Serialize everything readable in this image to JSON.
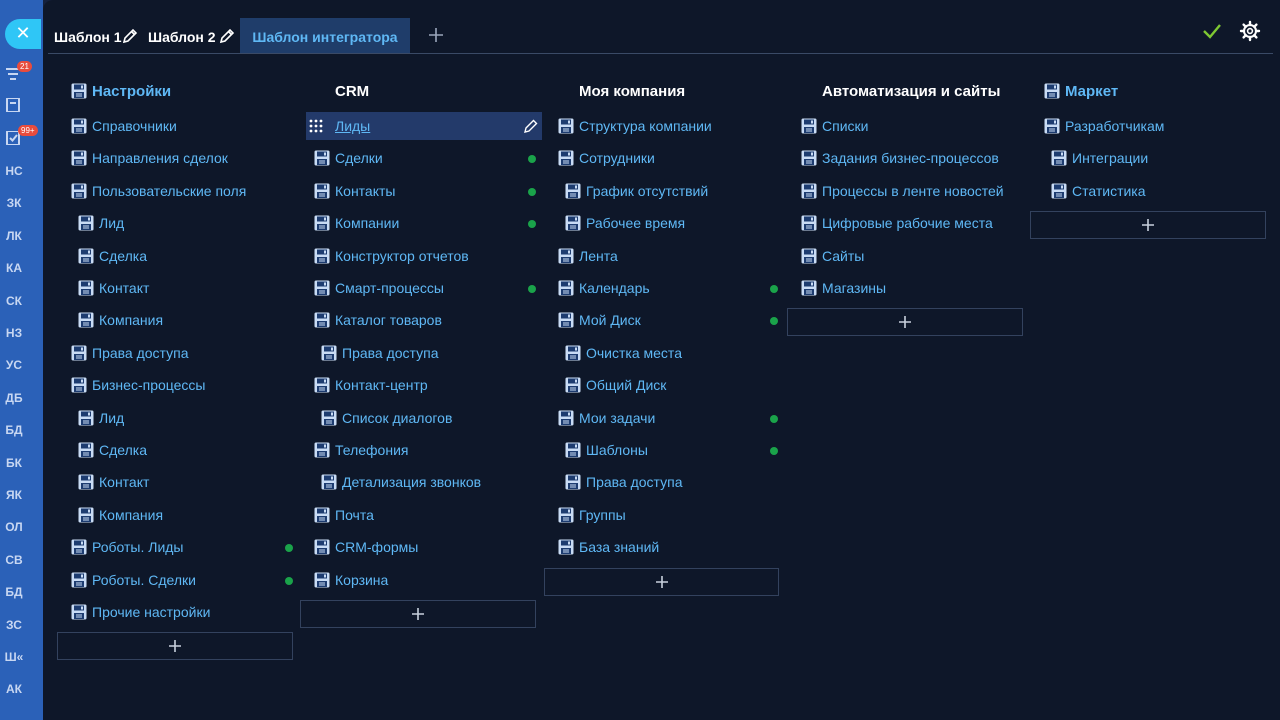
{
  "left_rail": {
    "filter_badge": "21",
    "tasks_badge": "99+",
    "abbreviations": [
      "НС",
      "ЗК",
      "ЛК",
      "КА",
      "СК",
      "НЗ",
      "УС",
      "ДБ",
      "БД",
      "БК",
      "ЯК",
      "ОЛ",
      "СВ",
      "БД",
      "ЗС",
      "Ш«",
      "АК"
    ]
  },
  "tabs": [
    {
      "label": "Шаблон 1"
    },
    {
      "label": "Шаблон 2"
    },
    {
      "label": "Шаблон интегратора",
      "active": true
    }
  ],
  "columns": [
    {
      "title": "Настройки",
      "title_is_link": true,
      "items": [
        {
          "label": "Справочники",
          "level": 0
        },
        {
          "label": "Направления сделок",
          "level": 0
        },
        {
          "label": "Пользовательские поля",
          "level": 0
        },
        {
          "label": "Лид",
          "level": 1
        },
        {
          "label": "Сделка",
          "level": 1
        },
        {
          "label": "Контакт",
          "level": 1
        },
        {
          "label": "Компания",
          "level": 1
        },
        {
          "label": "Права доступа",
          "level": 0
        },
        {
          "label": "Бизнес-процессы",
          "level": 0
        },
        {
          "label": "Лид",
          "level": 1
        },
        {
          "label": "Сделка",
          "level": 1
        },
        {
          "label": "Контакт",
          "level": 1
        },
        {
          "label": "Компания",
          "level": 1
        },
        {
          "label": "Роботы. Лиды",
          "level": 0,
          "status": "active"
        },
        {
          "label": "Роботы. Сделки",
          "level": 0,
          "status": "active"
        },
        {
          "label": "Прочие настройки",
          "level": 0
        }
      ]
    },
    {
      "title": "CRM",
      "title_is_link": false,
      "items": [
        {
          "label": "Лиды",
          "level": 0,
          "highlighted": true
        },
        {
          "label": "Сделки",
          "level": 0,
          "status": "active"
        },
        {
          "label": "Контакты",
          "level": 0,
          "status": "active"
        },
        {
          "label": "Компании",
          "level": 0,
          "status": "active"
        },
        {
          "label": "Конструктор отчетов",
          "level": 0
        },
        {
          "label": "Смарт-процессы",
          "level": 0,
          "status": "active"
        },
        {
          "label": "Каталог товаров",
          "level": 0
        },
        {
          "label": "Права доступа",
          "level": 1
        },
        {
          "label": "Контакт-центр",
          "level": 0
        },
        {
          "label": "Список диалогов",
          "level": 1
        },
        {
          "label": "Телефония",
          "level": 0
        },
        {
          "label": "Детализация звонков",
          "level": 1
        },
        {
          "label": "Почта",
          "level": 0
        },
        {
          "label": "CRM-формы",
          "level": 0
        },
        {
          "label": "Корзина",
          "level": 0
        }
      ]
    },
    {
      "title": "Моя компания",
      "title_is_link": false,
      "items": [
        {
          "label": "Структура компании",
          "level": 0
        },
        {
          "label": "Сотрудники",
          "level": 0
        },
        {
          "label": "График отсутствий",
          "level": 1
        },
        {
          "label": "Рабочее время",
          "level": 1
        },
        {
          "label": "Лента",
          "level": 0
        },
        {
          "label": "Календарь",
          "level": 0,
          "status": "active"
        },
        {
          "label": "Мой Диск",
          "level": 0,
          "status": "active"
        },
        {
          "label": "Очистка места",
          "level": 1
        },
        {
          "label": "Общий Диск",
          "level": 1
        },
        {
          "label": "Мои задачи",
          "level": 0,
          "status": "active"
        },
        {
          "label": "Шаблоны",
          "level": 1,
          "status": "active"
        },
        {
          "label": "Права доступа",
          "level": 1
        },
        {
          "label": "Группы",
          "level": 0
        },
        {
          "label": "База знаний",
          "level": 0
        }
      ]
    },
    {
      "title": "Автоматизация и сайты",
      "title_is_link": false,
      "items": [
        {
          "label": "Списки",
          "level": 0
        },
        {
          "label": "Задания бизнес-процессов",
          "level": 0
        },
        {
          "label": "Процессы в ленте новостей",
          "level": 0
        },
        {
          "label": "Цифровые рабочие места",
          "level": 0
        },
        {
          "label": "Сайты",
          "level": 0
        },
        {
          "label": "Магазины",
          "level": 0
        }
      ]
    },
    {
      "title": "Маркет",
      "title_is_link": true,
      "items": [
        {
          "label": "Разработчикам",
          "level": 0
        },
        {
          "label": "Интеграции",
          "level": 1
        },
        {
          "label": "Статистика",
          "level": 1
        }
      ]
    }
  ],
  "colors": {
    "panel_bg": "#0e1729",
    "left_rail_bg": "#2b61b8",
    "link": "#5fb8f5",
    "status_dot": "#1aa34a",
    "active_tab_bg": "#1f3d6a",
    "accept_check": "#7ec832"
  },
  "icons": {
    "close": "close-icon",
    "accept": "check-icon",
    "settings": "gear-icon",
    "add_tab": "plus-icon",
    "edit": "pencil-icon",
    "drag": "drag-handle-icon",
    "item": "floppy-disk-icon"
  }
}
